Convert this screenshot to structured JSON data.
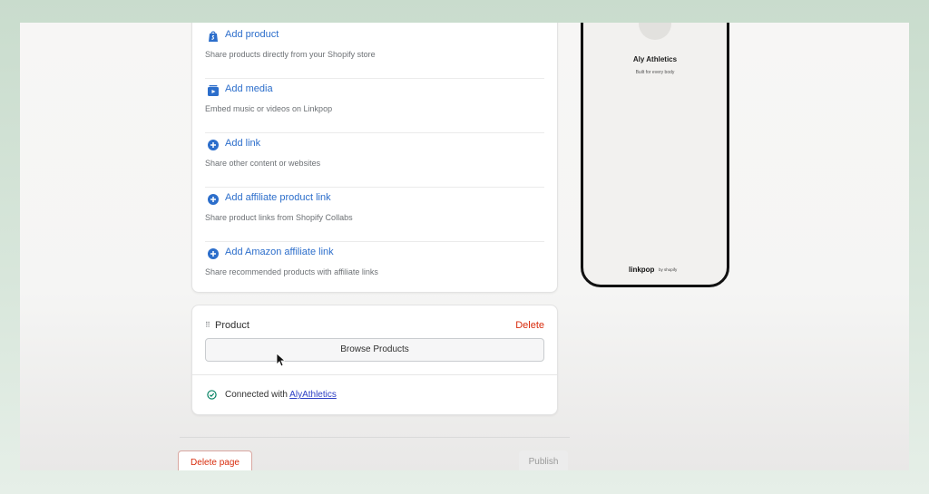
{
  "add_options": [
    {
      "title": "Add product",
      "description": "Share products directly from your Shopify store",
      "icon": "shopify-bag-icon"
    },
    {
      "title": "Add media",
      "description": "Embed music or videos on Linkpop",
      "icon": "media-icon"
    },
    {
      "title": "Add link",
      "description": "Share other content or websites",
      "icon": "plus-circle-icon"
    },
    {
      "title": "Add affiliate product link",
      "description": "Share product links from Shopify Collabs",
      "icon": "plus-circle-icon"
    },
    {
      "title": "Add Amazon affiliate link",
      "description": "Share recommended products with affiliate links",
      "icon": "plus-circle-icon"
    }
  ],
  "product_block": {
    "drag_handle": "⠿",
    "title": "Product",
    "delete_label": "Delete",
    "browse_label": "Browse Products",
    "connected_prefix": "Connected with",
    "connected_store": "AlyAthletics"
  },
  "footer": {
    "delete_page_label": "Delete page",
    "publish_label": "Publish"
  },
  "preview": {
    "store_name": "Aly Athletics",
    "tagline": "Built for every body",
    "brand": "linkpop",
    "brand_sub": "by shopify"
  },
  "colors": {
    "link_blue": "#2c6ecb",
    "danger_red": "#d82c0d",
    "success_green": "#008060"
  }
}
